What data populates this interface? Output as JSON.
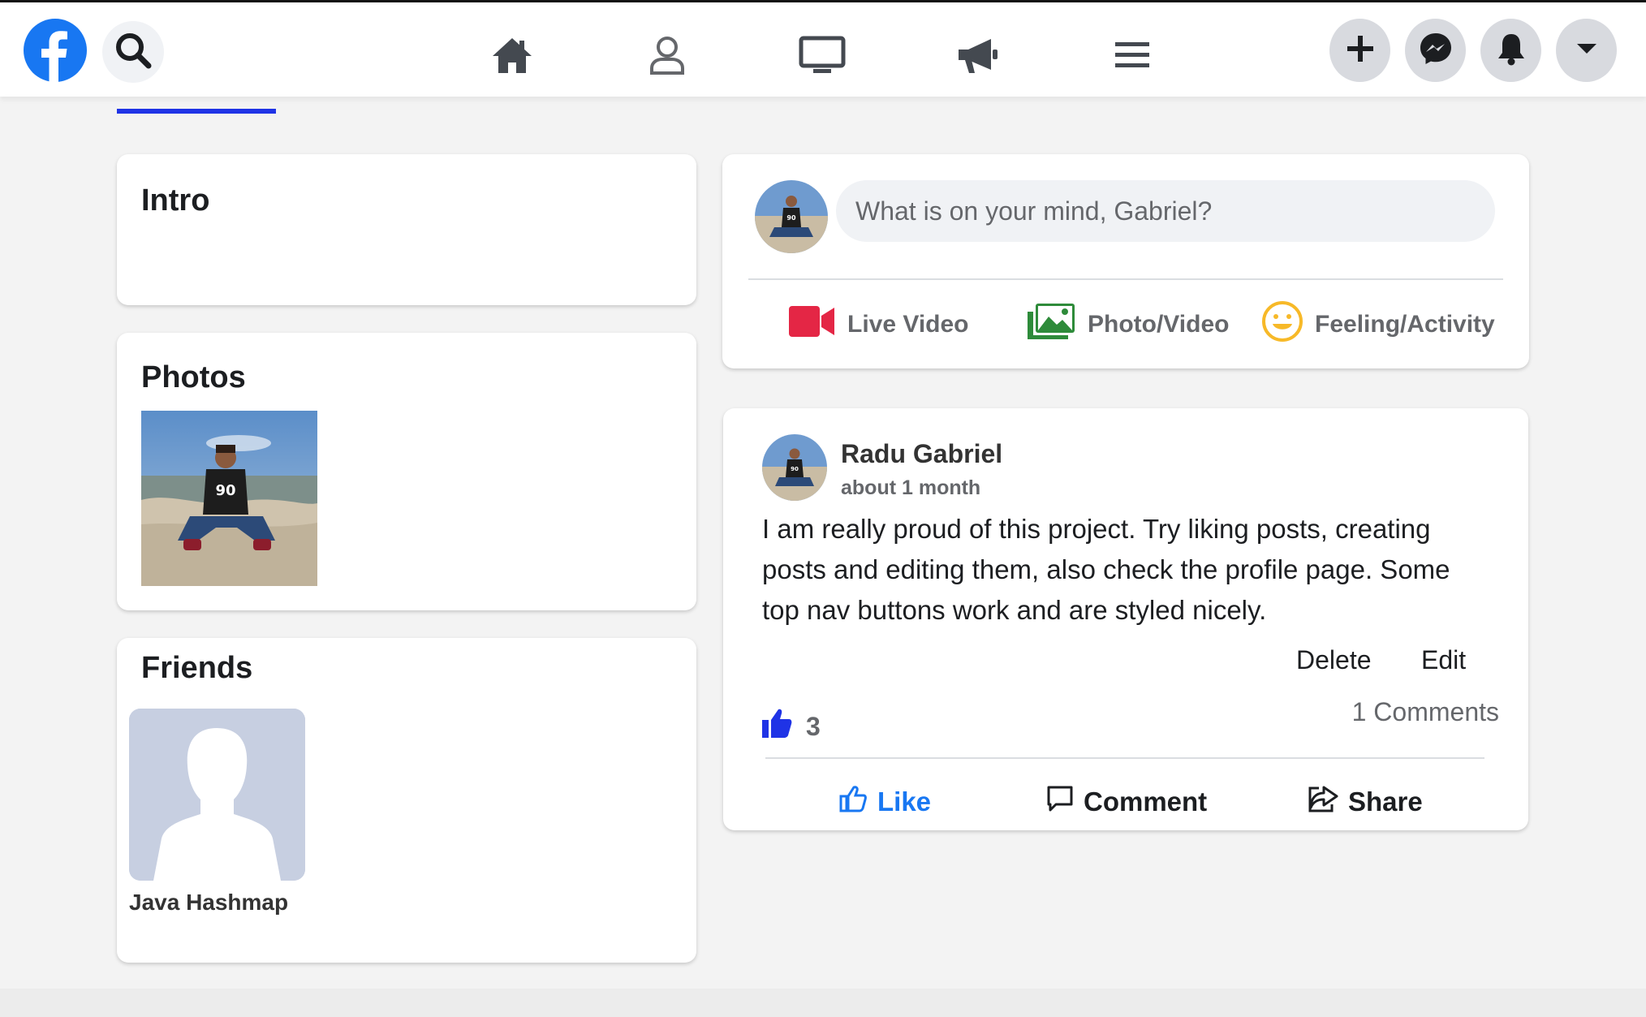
{
  "colors": {
    "brand_blue": "#1877f2",
    "like_blue": "#1f33e6",
    "live_red": "#e42645",
    "photo_green": "#2e8b3a",
    "feeling_yellow": "#f7b928",
    "icon_gray": "#444950",
    "page_bg": "#f3f3f3"
  },
  "nav": {
    "logo_icon": "facebook-logo",
    "search_icon": "search-icon",
    "center_icons": [
      "home-icon",
      "profile-icon",
      "watch-icon",
      "megaphone-icon",
      "menu-icon"
    ],
    "right_buttons": [
      "plus-icon",
      "messenger-icon",
      "bell-icon",
      "caret-down-icon"
    ]
  },
  "intro": {
    "title": "Intro"
  },
  "photos": {
    "title": "Photos"
  },
  "friends": {
    "title": "Friends",
    "items": [
      {
        "name": "Java Hashmap"
      }
    ]
  },
  "composer": {
    "placeholder": "What is on your mind, Gabriel?",
    "actions": [
      {
        "label": "Live Video",
        "icon": "video-camera-icon"
      },
      {
        "label": "Photo/Video",
        "icon": "photos-icon"
      },
      {
        "label": "Feeling/Activity",
        "icon": "smiley-icon"
      }
    ]
  },
  "post": {
    "author": "Radu Gabriel",
    "time": "about 1 month",
    "body": "I am really proud of this project. Try liking posts, creating posts and editing them, also check the profile page. Some top nav buttons work and are styled nicely.",
    "delete_label": "Delete",
    "edit_label": "Edit",
    "like_count": "3",
    "comments_label": "1 Comments",
    "like_label": "Like",
    "comment_label": "Comment",
    "share_label": "Share"
  }
}
